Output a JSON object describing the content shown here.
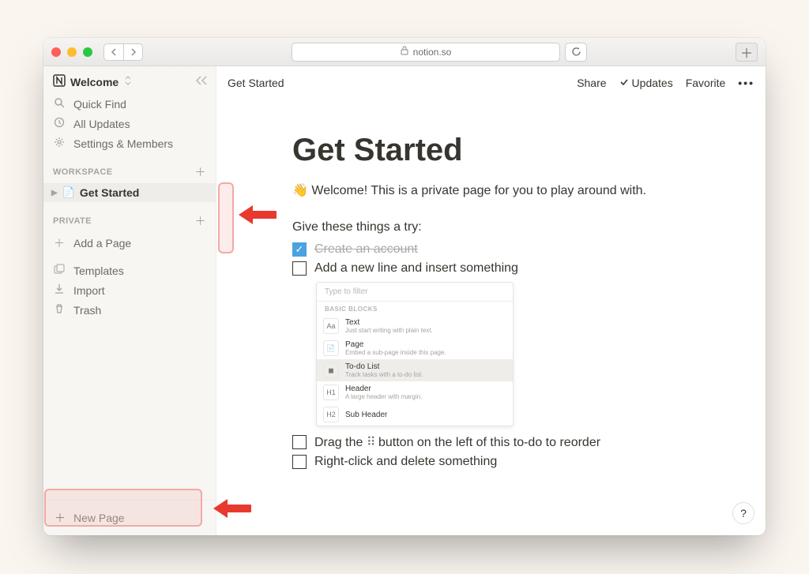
{
  "browser": {
    "url_host": "notion.so"
  },
  "sidebar": {
    "workspace_name": "Welcome",
    "quick_find": "Quick Find",
    "all_updates": "All Updates",
    "settings": "Settings & Members",
    "section_workspace": "WORKSPACE",
    "section_private": "PRIVATE",
    "page_get_started": "Get Started",
    "add_a_page": "Add a Page",
    "templates": "Templates",
    "import": "Import",
    "trash": "Trash",
    "new_page": "New Page"
  },
  "topbar": {
    "breadcrumb": "Get Started",
    "share": "Share",
    "updates": "Updates",
    "favorite": "Favorite"
  },
  "page": {
    "title": "Get Started",
    "welcome_emoji": "👋",
    "welcome_text": "Welcome! This is a private page for you to play around with.",
    "try_heading": "Give these things a try:",
    "todos": {
      "create_account": "Create an account",
      "add_line": "Add a new line and insert something",
      "drag_pre": "Drag the ",
      "drag_post": " button on the left of this to-do to reorder",
      "right_click": "Right-click and delete something"
    }
  },
  "popup": {
    "filter_placeholder": "Type to filter",
    "category": "BASIC BLOCKS",
    "options": [
      {
        "icon": "Aa",
        "title": "Text",
        "desc": "Just start writing with plain text."
      },
      {
        "icon": "📄",
        "title": "Page",
        "desc": "Embed a sub-page inside this page."
      },
      {
        "icon": "◼",
        "title": "To-do List",
        "desc": "Track tasks with a to-do list."
      },
      {
        "icon": "H1",
        "title": "Header",
        "desc": "A large header with margin."
      },
      {
        "icon": "H2",
        "title": "Sub Header",
        "desc": ""
      }
    ]
  },
  "help": "?"
}
